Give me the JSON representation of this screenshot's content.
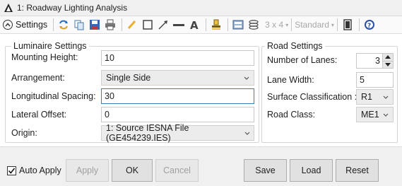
{
  "window": {
    "title": "1: Roadway Lighting Analysis"
  },
  "toolbar": {
    "settings_label": "Settings",
    "layout_label": "3 x 4",
    "style_label": "Standard"
  },
  "luminaire": {
    "legend": "Luminaire Settings",
    "mounting_height": {
      "label": "Mounting Height:",
      "value": "10"
    },
    "arrangement": {
      "label": "Arrangement:",
      "value": "Single Side"
    },
    "longitudinal_spacing": {
      "label": "Longitudinal Spacing:",
      "value": "30"
    },
    "lateral_offset": {
      "label": "Lateral Offset:",
      "value": "0"
    },
    "origin": {
      "label": "Origin:",
      "value": "1: Source IESNA File (GE454239.IES)"
    }
  },
  "road": {
    "legend": "Road Settings",
    "lanes": {
      "label": "Number of Lanes:",
      "value": "3"
    },
    "lane_width": {
      "label": "Lane Width:",
      "value": "5"
    },
    "surface": {
      "label": "Surface Classification :",
      "value": "R1"
    },
    "road_class": {
      "label": "Road Class:",
      "value": "ME1"
    }
  },
  "buttons": {
    "auto_apply": "Auto Apply",
    "apply": "Apply",
    "ok": "OK",
    "cancel": "Cancel",
    "save": "Save",
    "load": "Load",
    "reset": "Reset"
  },
  "colors": {
    "accent": "#3c7fb1",
    "background": "#f0f0f0",
    "panel": "#ffffff"
  }
}
